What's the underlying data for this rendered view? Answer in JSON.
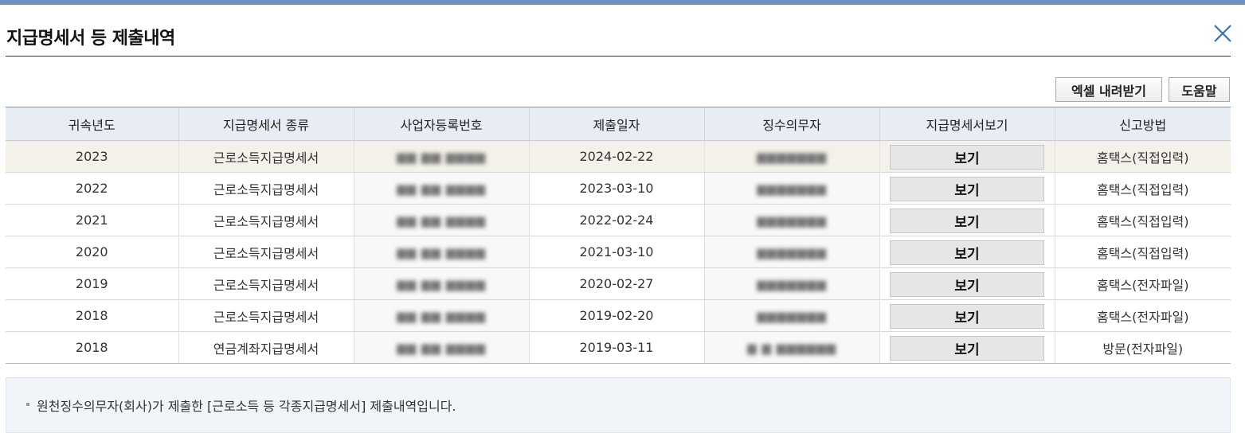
{
  "dialog": {
    "title": "지급명세서 등 제출내역",
    "close_icon": "close-icon"
  },
  "toolbar": {
    "excel_label": "엑셀 내려받기",
    "help_label": "도움말"
  },
  "table": {
    "headers": [
      "귀속년도",
      "지급명세서 종류",
      "사업자등록번호",
      "제출일자",
      "징수의무자",
      "지급명세서보기",
      "신고방법"
    ],
    "view_label": "보기",
    "rows": [
      {
        "year": "2023",
        "type": "근로소득지급명세서",
        "date": "2024-02-22",
        "method": "홈택스(직접입력)"
      },
      {
        "year": "2022",
        "type": "근로소득지급명세서",
        "date": "2023-03-10",
        "method": "홈택스(직접입력)"
      },
      {
        "year": "2021",
        "type": "근로소득지급명세서",
        "date": "2022-02-24",
        "method": "홈택스(직접입력)"
      },
      {
        "year": "2020",
        "type": "근로소득지급명세서",
        "date": "2021-03-10",
        "method": "홈택스(직접입력)"
      },
      {
        "year": "2019",
        "type": "근로소득지급명세서",
        "date": "2020-02-27",
        "method": "홈택스(전자파일)"
      },
      {
        "year": "2018",
        "type": "근로소득지급명세서",
        "date": "2019-02-20",
        "method": "홈택스(전자파일)"
      },
      {
        "year": "2018",
        "type": "연금계좌지급명세서",
        "date": "2019-03-11",
        "method": "방문(전자파일)"
      }
    ]
  },
  "notice": {
    "text": "원천징수의무자(회사)가 제출한 [근로소득 등 각종지급명세서] 제출내역입니다."
  },
  "colors": {
    "top_bar": "#6f8fbf",
    "header_bg": "#e8edf5",
    "selected_row_bg": "#f4f0ea",
    "notice_bg": "#f1f4f9"
  }
}
